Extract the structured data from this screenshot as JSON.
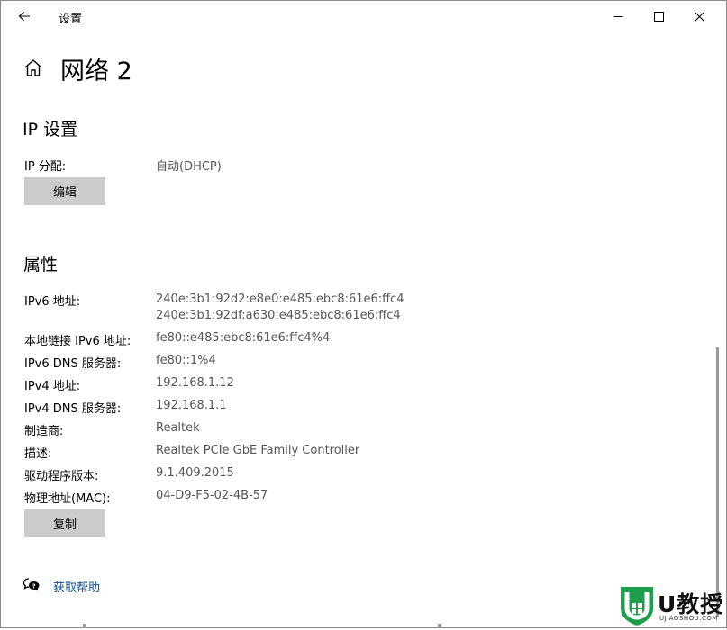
{
  "window": {
    "title": "设置"
  },
  "page": {
    "title": "网络 2"
  },
  "ip_section": {
    "title": "IP 设置",
    "assignment_label": "IP 分配:",
    "assignment_value": "自动(DHCP)",
    "edit_button": "编辑"
  },
  "properties": {
    "title": "属性",
    "rows": [
      {
        "label": "IPv6 地址:",
        "values": [
          "240e:3b1:92d2:e8e0:e485:ebc8:61e6:ffc4",
          "240e:3b1:92df:a630:e485:ebc8:61e6:ffc4"
        ]
      },
      {
        "label": "本地链接 IPv6 地址:",
        "value": "fe80::e485:ebc8:61e6:ffc4%4"
      },
      {
        "label": "IPv6 DNS 服务器:",
        "value": "fe80::1%4"
      },
      {
        "label": "IPv4 地址:",
        "value": "192.168.1.12"
      },
      {
        "label": "IPv4 DNS 服务器:",
        "value": "192.168.1.1"
      },
      {
        "label": "制造商:",
        "value": "Realtek"
      },
      {
        "label": "描述:",
        "value": "Realtek PCIe GbE Family Controller"
      },
      {
        "label": "驱动程序版本:",
        "value": "9.1.409.2015"
      },
      {
        "label": "物理地址(MAC):",
        "value": "04-D9-F5-02-4B-57"
      }
    ],
    "copy_button": "复制"
  },
  "help": {
    "link": "获取帮助"
  },
  "watermark": {
    "brand": "U教授",
    "url": "UJIAOSHOU.COM"
  },
  "colors": {
    "button_bg": "#cccccc",
    "link": "#0b4f96",
    "value_text": "#555555",
    "watermark_green": "#1e9e4a"
  }
}
